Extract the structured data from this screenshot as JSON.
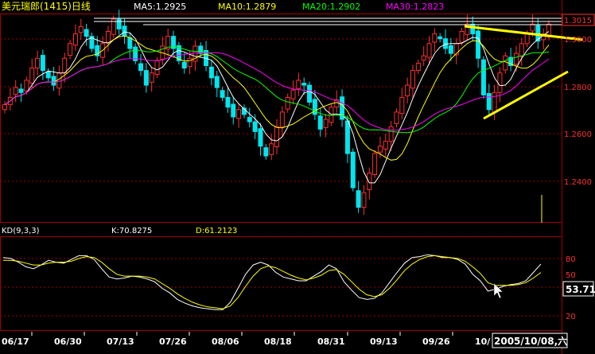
{
  "header": {
    "title": "美元瑞郎(1415)日线",
    "ma5": "MA5:1.2925",
    "ma10": "MA10:1.2879",
    "ma20": "MA20:1.2902",
    "ma30": "MA30:1.2823"
  },
  "price_axis": {
    "labels": [
      "1.3015",
      "1.3000",
      "1.2800",
      "1.2600",
      "1.2400"
    ],
    "current_price": "1.3015"
  },
  "kd_panel": {
    "label": "KD(9,3,3)",
    "k": "K:70.8275",
    "d": "D:61.2123",
    "axis_labels": [
      "80",
      "50",
      "20"
    ],
    "current_value": "53.71"
  },
  "x_axis": {
    "labels": [
      "06/17",
      "06/30",
      "07/13",
      "07/26",
      "08/06",
      "08/18",
      "08/31",
      "09/13",
      "09/26",
      "10/"
    ],
    "cursor_date": "2005/10/08,六"
  },
  "colors": {
    "up": "#ff3030",
    "down": "#00e5ee",
    "ma5": "#ffffff",
    "ma10": "#ffff00",
    "ma20": "#00ff00",
    "ma30": "#ff00ff",
    "grid": "#a00000",
    "trendline": "#ffff00"
  },
  "chart_data": [
    {
      "type": "candlestick",
      "series": [
        {
          "name": "MA5",
          "value": 1.2925
        },
        {
          "name": "MA10",
          "value": 1.2879
        },
        {
          "name": "MA20",
          "value": 1.2902
        },
        {
          "name": "MA30",
          "value": 1.2823
        }
      ],
      "ylim": [
        1.22,
        1.305
      ],
      "candles_close": [
        1.268,
        1.271,
        1.275,
        1.273,
        1.278,
        1.283,
        1.287,
        1.282,
        1.279,
        1.276,
        1.281,
        1.287,
        1.293,
        1.297,
        1.3,
        1.296,
        1.291,
        1.288,
        1.293,
        1.298,
        1.303,
        1.299,
        1.296,
        1.291,
        1.286,
        1.282,
        1.276,
        1.281,
        1.286,
        1.292,
        1.296,
        1.291,
        1.286,
        1.283,
        1.287,
        1.292,
        1.289,
        1.284,
        1.279,
        1.275,
        1.271,
        1.267,
        1.263,
        1.266,
        1.264,
        1.261,
        1.257,
        1.251,
        1.247,
        1.252,
        1.259,
        1.265,
        1.271,
        1.274,
        1.278,
        1.276,
        1.269,
        1.264,
        1.258,
        1.262,
        1.267,
        1.27,
        1.262,
        1.248,
        1.234,
        1.226,
        1.232,
        1.24,
        1.248,
        1.251,
        1.253,
        1.259,
        1.265,
        1.271,
        1.276,
        1.282,
        1.285,
        1.288,
        1.293,
        1.297,
        1.295,
        1.291,
        1.289,
        1.293,
        1.298,
        1.301,
        1.297,
        1.287,
        1.272,
        1.266,
        1.273,
        1.281,
        1.288,
        1.284,
        1.289,
        1.293,
        1.297,
        1.301,
        1.294,
        1.297,
        1.301
      ]
    },
    {
      "type": "line",
      "series": [
        {
          "name": "K",
          "values": [
            78,
            77,
            73,
            68,
            66,
            70,
            75,
            73,
            72,
            76,
            80,
            80,
            76,
            66,
            57,
            55,
            56,
            58,
            57,
            55,
            52,
            45,
            40,
            33,
            29,
            26,
            24,
            23,
            22,
            22,
            30,
            45,
            60,
            70,
            73,
            70,
            62,
            57,
            55,
            53,
            53,
            58,
            63,
            70,
            66,
            52,
            43,
            35,
            33,
            34,
            40,
            51,
            62,
            72,
            78,
            79,
            81,
            80,
            78,
            78,
            76,
            71,
            60,
            53,
            42,
            44,
            47,
            49,
            50,
            53,
            62,
            71
          ]
        },
        {
          "name": "D",
          "values": [
            75,
            75,
            74,
            72,
            70,
            70,
            72,
            73,
            73,
            74,
            77,
            79,
            78,
            73,
            66,
            60,
            58,
            58,
            58,
            57,
            55,
            50,
            45,
            39,
            34,
            30,
            27,
            25,
            24,
            23,
            26,
            35,
            47,
            58,
            66,
            69,
            67,
            63,
            59,
            56,
            54,
            56,
            59,
            64,
            65,
            60,
            52,
            44,
            38,
            36,
            38,
            45,
            54,
            64,
            71,
            76,
            79,
            80,
            79,
            78,
            77,
            74,
            68,
            61,
            51,
            48,
            48,
            48,
            49,
            51,
            56,
            62
          ]
        }
      ],
      "ylim": [
        0,
        100
      ]
    }
  ]
}
